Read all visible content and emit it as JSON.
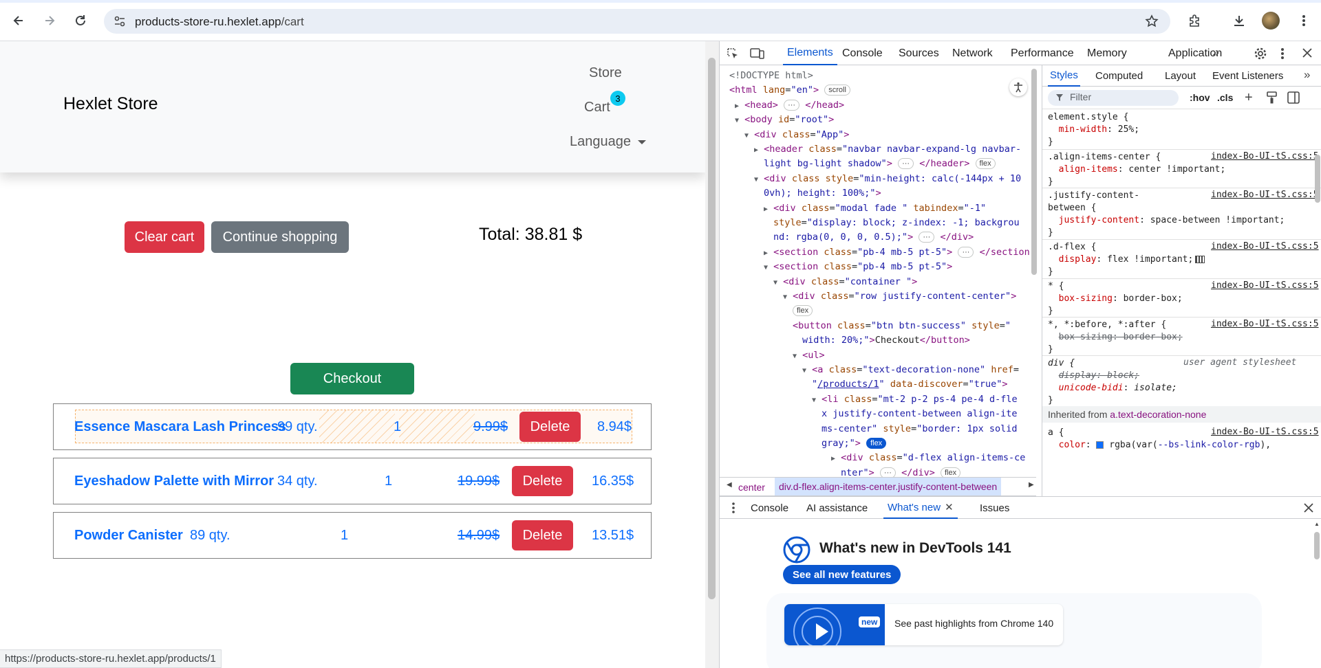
{
  "browser": {
    "url_host": "products-store-ru.hexlet.app",
    "url_path": "/cart"
  },
  "page": {
    "brand": "Hexlet Store",
    "nav": {
      "store": "Store",
      "cart": "Cart",
      "cart_count": "3",
      "language": "Language"
    },
    "buttons": {
      "clear_cart": "Clear cart",
      "continue_shopping": "Continue shopping",
      "checkout": "Checkout"
    },
    "total": "Total: 38.81 $",
    "items": [
      {
        "name": "Essence Mascara Lash Princess",
        "stock": "99 qty.",
        "quantity": "1",
        "old_price": "9.99$",
        "delete": "Delete",
        "price": "8.94$"
      },
      {
        "name": "Eyeshadow Palette with Mirror",
        "stock": "34 qty.",
        "quantity": "1",
        "old_price": "19.99$",
        "delete": "Delete",
        "price": "16.35$"
      },
      {
        "name": "Powder Canister",
        "stock": "89 qty.",
        "quantity": "1",
        "old_price": "14.99$",
        "delete": "Delete",
        "price": "13.51$"
      }
    ],
    "status_url": "https://products-store-ru.hexlet.app/products/1"
  },
  "devtools": {
    "tabs": [
      "Elements",
      "Console",
      "Sources",
      "Network",
      "Performance",
      "Memory",
      "Application"
    ],
    "active_tab": "Elements",
    "elements_lines": [
      {
        "html": "<span class='cmt'>&lt;!DOCTYPE html&gt;</span>"
      },
      {
        "html": "<span class='tag'>&lt;html</span> <span class='attr'>lang</span>=<span class='val'>\"en\"</span><span class='tag'>&gt;</span> <span class='pill'>scroll</span>"
      },
      {
        "html": "<span class='tri'>▶</span> <span class='tag'>&lt;head&gt;</span> <span class='pill'>···</span> <span class='tag'>&lt;/head&gt;</span>"
      },
      {
        "html": "<span class='tri'>▼</span> <span class='tag'>&lt;body</span> <span class='attr'>id</span>=<span class='val'>\"root\"</span><span class='tag'>&gt;</span>"
      },
      {
        "html": "<span class='tri'>▼</span> <span class='tag'>&lt;div</span> <span class='attr'>class</span>=<span class='val'>\"App\"</span><span class='tag'>&gt;</span>"
      },
      {
        "html": "<span class='tri'>▶</span> <span class='tag'>&lt;header</span> <span class='attr'>class</span>=<span class='val'>\"navbar navbar-expand-lg navbar-</span>"
      },
      {
        "html": "<span class='val'>light bg-light shadow\"</span><span class='tag'>&gt;</span> <span class='pill'>···</span> <span class='tag'>&lt;/header&gt;</span> <span class='pill'>flex</span>"
      },
      {
        "html": "<span class='tri'>▼</span> <span class='tag'>&lt;div</span> <span class='attr'>class</span> <span class='attr'>style</span>=<span class='val'>\"min-height: calc(-144px + 10</span>"
      },
      {
        "html": "<span class='val'>0vh); height: 100%;\"</span><span class='tag'>&gt;</span>"
      },
      {
        "html": "<span class='tri'>▶</span> <span class='tag'>&lt;div</span> <span class='attr'>class</span>=<span class='val'>\"modal fade \"</span> <span class='attr'>tabindex</span>=<span class='val'>\"-1\"</span>"
      },
      {
        "html": "<span class='attr'>style</span>=<span class='val'>\"display: block; z-index: -1; backgrou</span>"
      },
      {
        "html": "<span class='val'>nd: rgba(0, 0, 0, 0.5);\"</span><span class='tag'>&gt;</span> <span class='pill'>···</span> <span class='tag'>&lt;/div&gt;</span>"
      },
      {
        "html": "<span class='tri'>▶</span> <span class='tag'>&lt;section</span> <span class='attr'>class</span>=<span class='val'>\"pb-4 mb-5 pt-5\"</span><span class='tag'>&gt;</span> <span class='pill'>···</span> <span class='tag'>&lt;/section&gt;</span>"
      },
      {
        "html": "<span class='tri'>▼</span> <span class='tag'>&lt;section</span> <span class='attr'>class</span>=<span class='val'>\"pb-4 mb-5 pt-5\"</span><span class='tag'>&gt;</span>"
      },
      {
        "html": "<span class='tri'>▼</span> <span class='tag'>&lt;div</span> <span class='attr'>class</span>=<span class='val'>\"container \"</span><span class='tag'>&gt;</span>"
      },
      {
        "html": "<span class='tri'>▼</span> <span class='tag'>&lt;div</span> <span class='attr'>class</span>=<span class='val'>\"row justify-content-center\"</span><span class='tag'>&gt;</span>"
      },
      {
        "html": "<span class='pill'>flex</span>"
      },
      {
        "html": "<span class='tag'>&lt;button</span> <span class='attr'>class</span>=<span class='val'>\"btn btn-success\"</span> <span class='attr'>style</span>=<span class='val'>\"</span>"
      },
      {
        "html": "<span class='val'>width: 20%;\"</span><span class='tag'>&gt;</span><span class='txt'>Checkout</span><span class='tag'>&lt;/button&gt;</span>"
      },
      {
        "html": "<span class='tri'>▼</span> <span class='tag'>&lt;ul&gt;</span>"
      },
      {
        "html": "<span class='tri'>▼</span> <span class='tag'>&lt;a</span> <span class='attr'>class</span>=<span class='val'>\"text-decoration-none\"</span> <span class='attr'>href</span>=<span class='val'></span>"
      },
      {
        "html": "<span class='val'>\"<u>/products/1</u>\"</span> <span class='attr'>data-discover</span>=<span class='val'>\"true\"</span><span class='tag'>&gt;</span>"
      },
      {
        "html": "<span class='tri'>▼</span> <span class='tag'>&lt;li</span> <span class='attr'>class</span>=<span class='val'>\"mt-2 p-2 ps-4 pe-4 d-fle</span>"
      },
      {
        "html": "<span class='val'>x justify-content-between align-ite</span>"
      },
      {
        "html": "<span class='val'>ms-center\"</span> <span class='attr'>style</span>=<span class='val'>\"border: 1px solid</span>"
      },
      {
        "html": "<span class='val'>gray;\"</span><span class='tag'>&gt;</span> <span class='pill dark'>flex</span>"
      },
      {
        "html": "<span class='tri'>▶</span> <span class='tag'>&lt;div</span> <span class='attr'>class</span>=<span class='val'>\"d-flex  align-items-ce</span>"
      },
      {
        "html": "<span class='val'>nter\"</span><span class='tag'>&gt;</span> <span class='pill'>···</span> <span class='tag'>&lt;/div&gt;</span> <span class='pill'>flex</span>"
      }
    ],
    "breadcrumb": {
      "prev": "center",
      "current": "div.d-flex.align-items-center.justify-content-between"
    },
    "styles_tabs": [
      "Styles",
      "Computed",
      "Layout",
      "Event Listeners"
    ],
    "filter_placeholder": "Filter",
    "filter_tools": {
      "hov": ":hov",
      "cls": ".cls"
    },
    "source_file": "index-Bo-UI-tS.css:5",
    "ua_label": "user agent stylesheet",
    "inherited_label": "Inherited from",
    "inherited_from": "a.text-decoration-none",
    "drawer_tabs": [
      "Console",
      "AI assistance",
      "What's new",
      "Issues"
    ],
    "whats_new_title": "What's new in DevTools 141",
    "see_all": "See all new features",
    "highlight_badge": "new",
    "highlight_text": "See past highlights from Chrome 140",
    "colors": {
      "accent": "#0b57d0",
      "danger": "#dc3545",
      "success": "#198754",
      "secondary": "#6c757d",
      "link": "#0d6efd"
    }
  }
}
